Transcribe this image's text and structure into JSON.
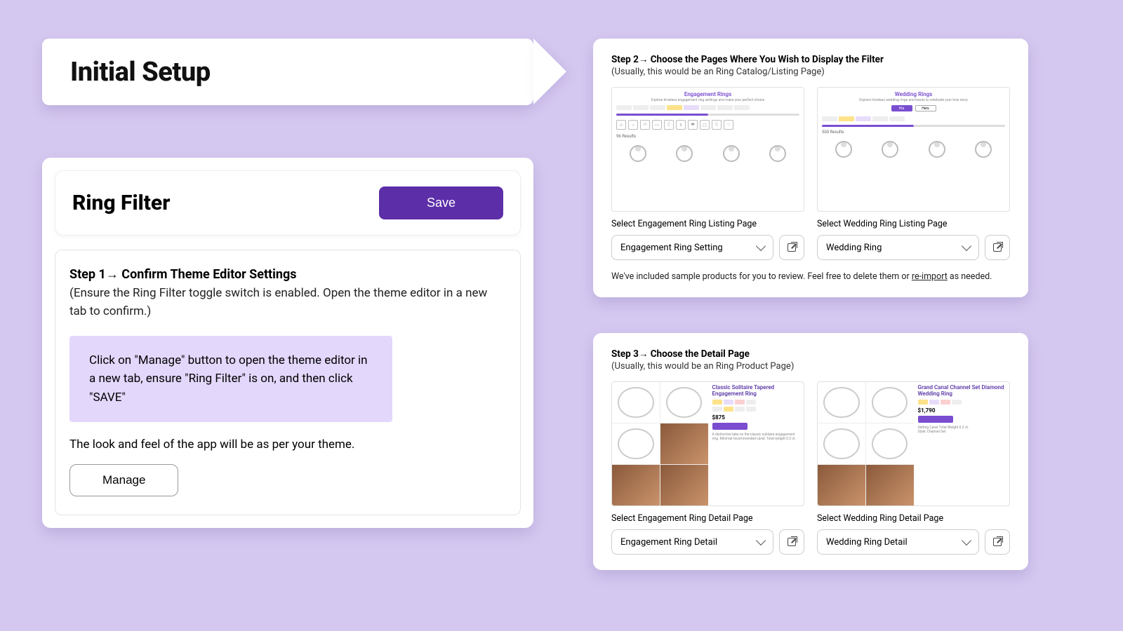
{
  "banner": {
    "title": "Initial Setup"
  },
  "colors": {
    "accent": "#5c2ea8",
    "bg": "#d5c8f0"
  },
  "step1": {
    "header_title": "Ring Filter",
    "save_label": "Save",
    "heading": "Step 1→  Confirm Theme Editor Settings",
    "sub": "(Ensure the Ring Filter toggle switch is enabled. Open the theme editor in a new tab to confirm.)",
    "hint": "Click on \"Manage\" button to open the theme editor in a new tab, ensure \"Ring Filter\" is on, and then click \"SAVE\"",
    "note": "The look and feel of the app will be as per your theme.",
    "manage_label": "Manage"
  },
  "step2": {
    "heading": "Step 2→ Choose the Pages Where You Wish to Display the Filter",
    "sub": "(Usually, this would be an Ring Catalog/Listing Page)",
    "left": {
      "thumb_title": "Engagement Rings",
      "select_label": "Select Engagement Ring Listing Page",
      "select_value": "Engagement Ring Setting"
    },
    "right": {
      "thumb_title": "Wedding Rings",
      "select_label": "Select Wedding Ring Listing Page",
      "select_value": "Wedding Ring"
    },
    "footnote_pre": "We've included sample products for you to review. Feel free to delete them or ",
    "footnote_link": "re-import",
    "footnote_post": " as needed."
  },
  "step3": {
    "heading": "Step 3→ Choose the Detail Page",
    "sub": "(Usually, this would be an Ring Product Page)",
    "left": {
      "thumb_title": "Classic Solitaire Tapered Engagement Ring",
      "price": "$875",
      "select_label": "Select Engagement Ring Detail Page",
      "select_value": "Engagement Ring Detail"
    },
    "right": {
      "thumb_title": "Grand Canal Channel Set Diamond Wedding Ring",
      "price": "$1,790",
      "select_label": "Select Wedding Ring Detail Page",
      "select_value": "Wedding Ring Detail"
    }
  }
}
